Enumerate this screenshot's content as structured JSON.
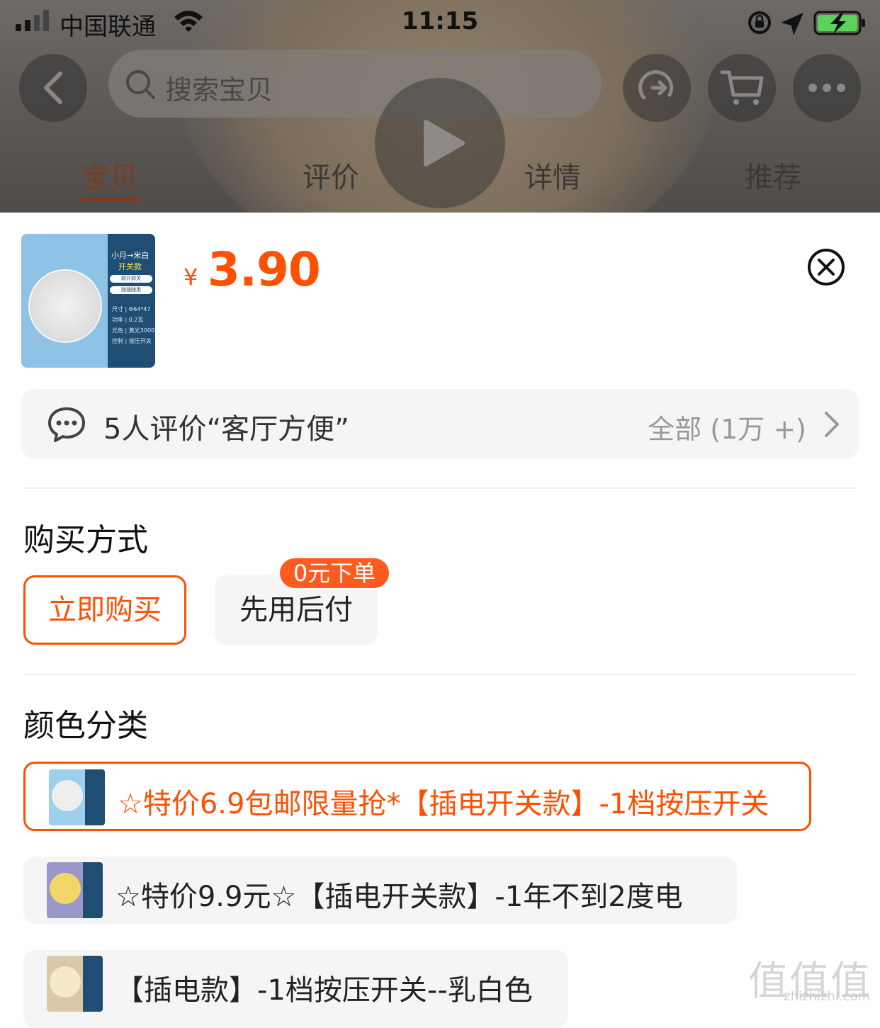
{
  "status_bar": {
    "carrier": "中国联通",
    "time": "11:15"
  },
  "search": {
    "placeholder": "搜索宝贝"
  },
  "tabs": [
    {
      "label": "宝贝",
      "active": true
    },
    {
      "label": "评价",
      "active": false
    },
    {
      "label": "详情",
      "active": false
    },
    {
      "label": "推荐",
      "active": false
    }
  ],
  "product": {
    "currency": "¥",
    "price": "3.90",
    "thumb": {
      "title": "小月→米白",
      "subtitle": "开关款",
      "pills": [
        "即开即关",
        "随插随用"
      ],
      "specs": [
        "尺寸 | Φ64*47",
        "功率 | 0.2瓦",
        "光色 | 黄光3000K",
        "控制 | 按压开关"
      ]
    }
  },
  "review": {
    "text": "5人评价“客厅方便”",
    "all": "全部 (1万 +)"
  },
  "purchase": {
    "title": "购买方式",
    "options": [
      "立即购买",
      "先用后付"
    ],
    "badge": "0元下单"
  },
  "color_section": {
    "title": "颜色分类",
    "variants": [
      {
        "label": "☆特价6.9包邮限量抢*【插电开关款】-1档按压开关",
        "selected": true
      },
      {
        "label": "☆特价9.9元☆【插电开关款】-1年不到2度电",
        "selected": false
      },
      {
        "label": "【插电款】-1档按压开关--乳白色",
        "selected": false
      }
    ]
  },
  "watermark": {
    "logo": "值值值",
    "domain": "zhizhizhi.com"
  },
  "colors": {
    "accent": "#ff5000",
    "tab_active": "#7d3d1d",
    "panel": "#1f4d73"
  }
}
